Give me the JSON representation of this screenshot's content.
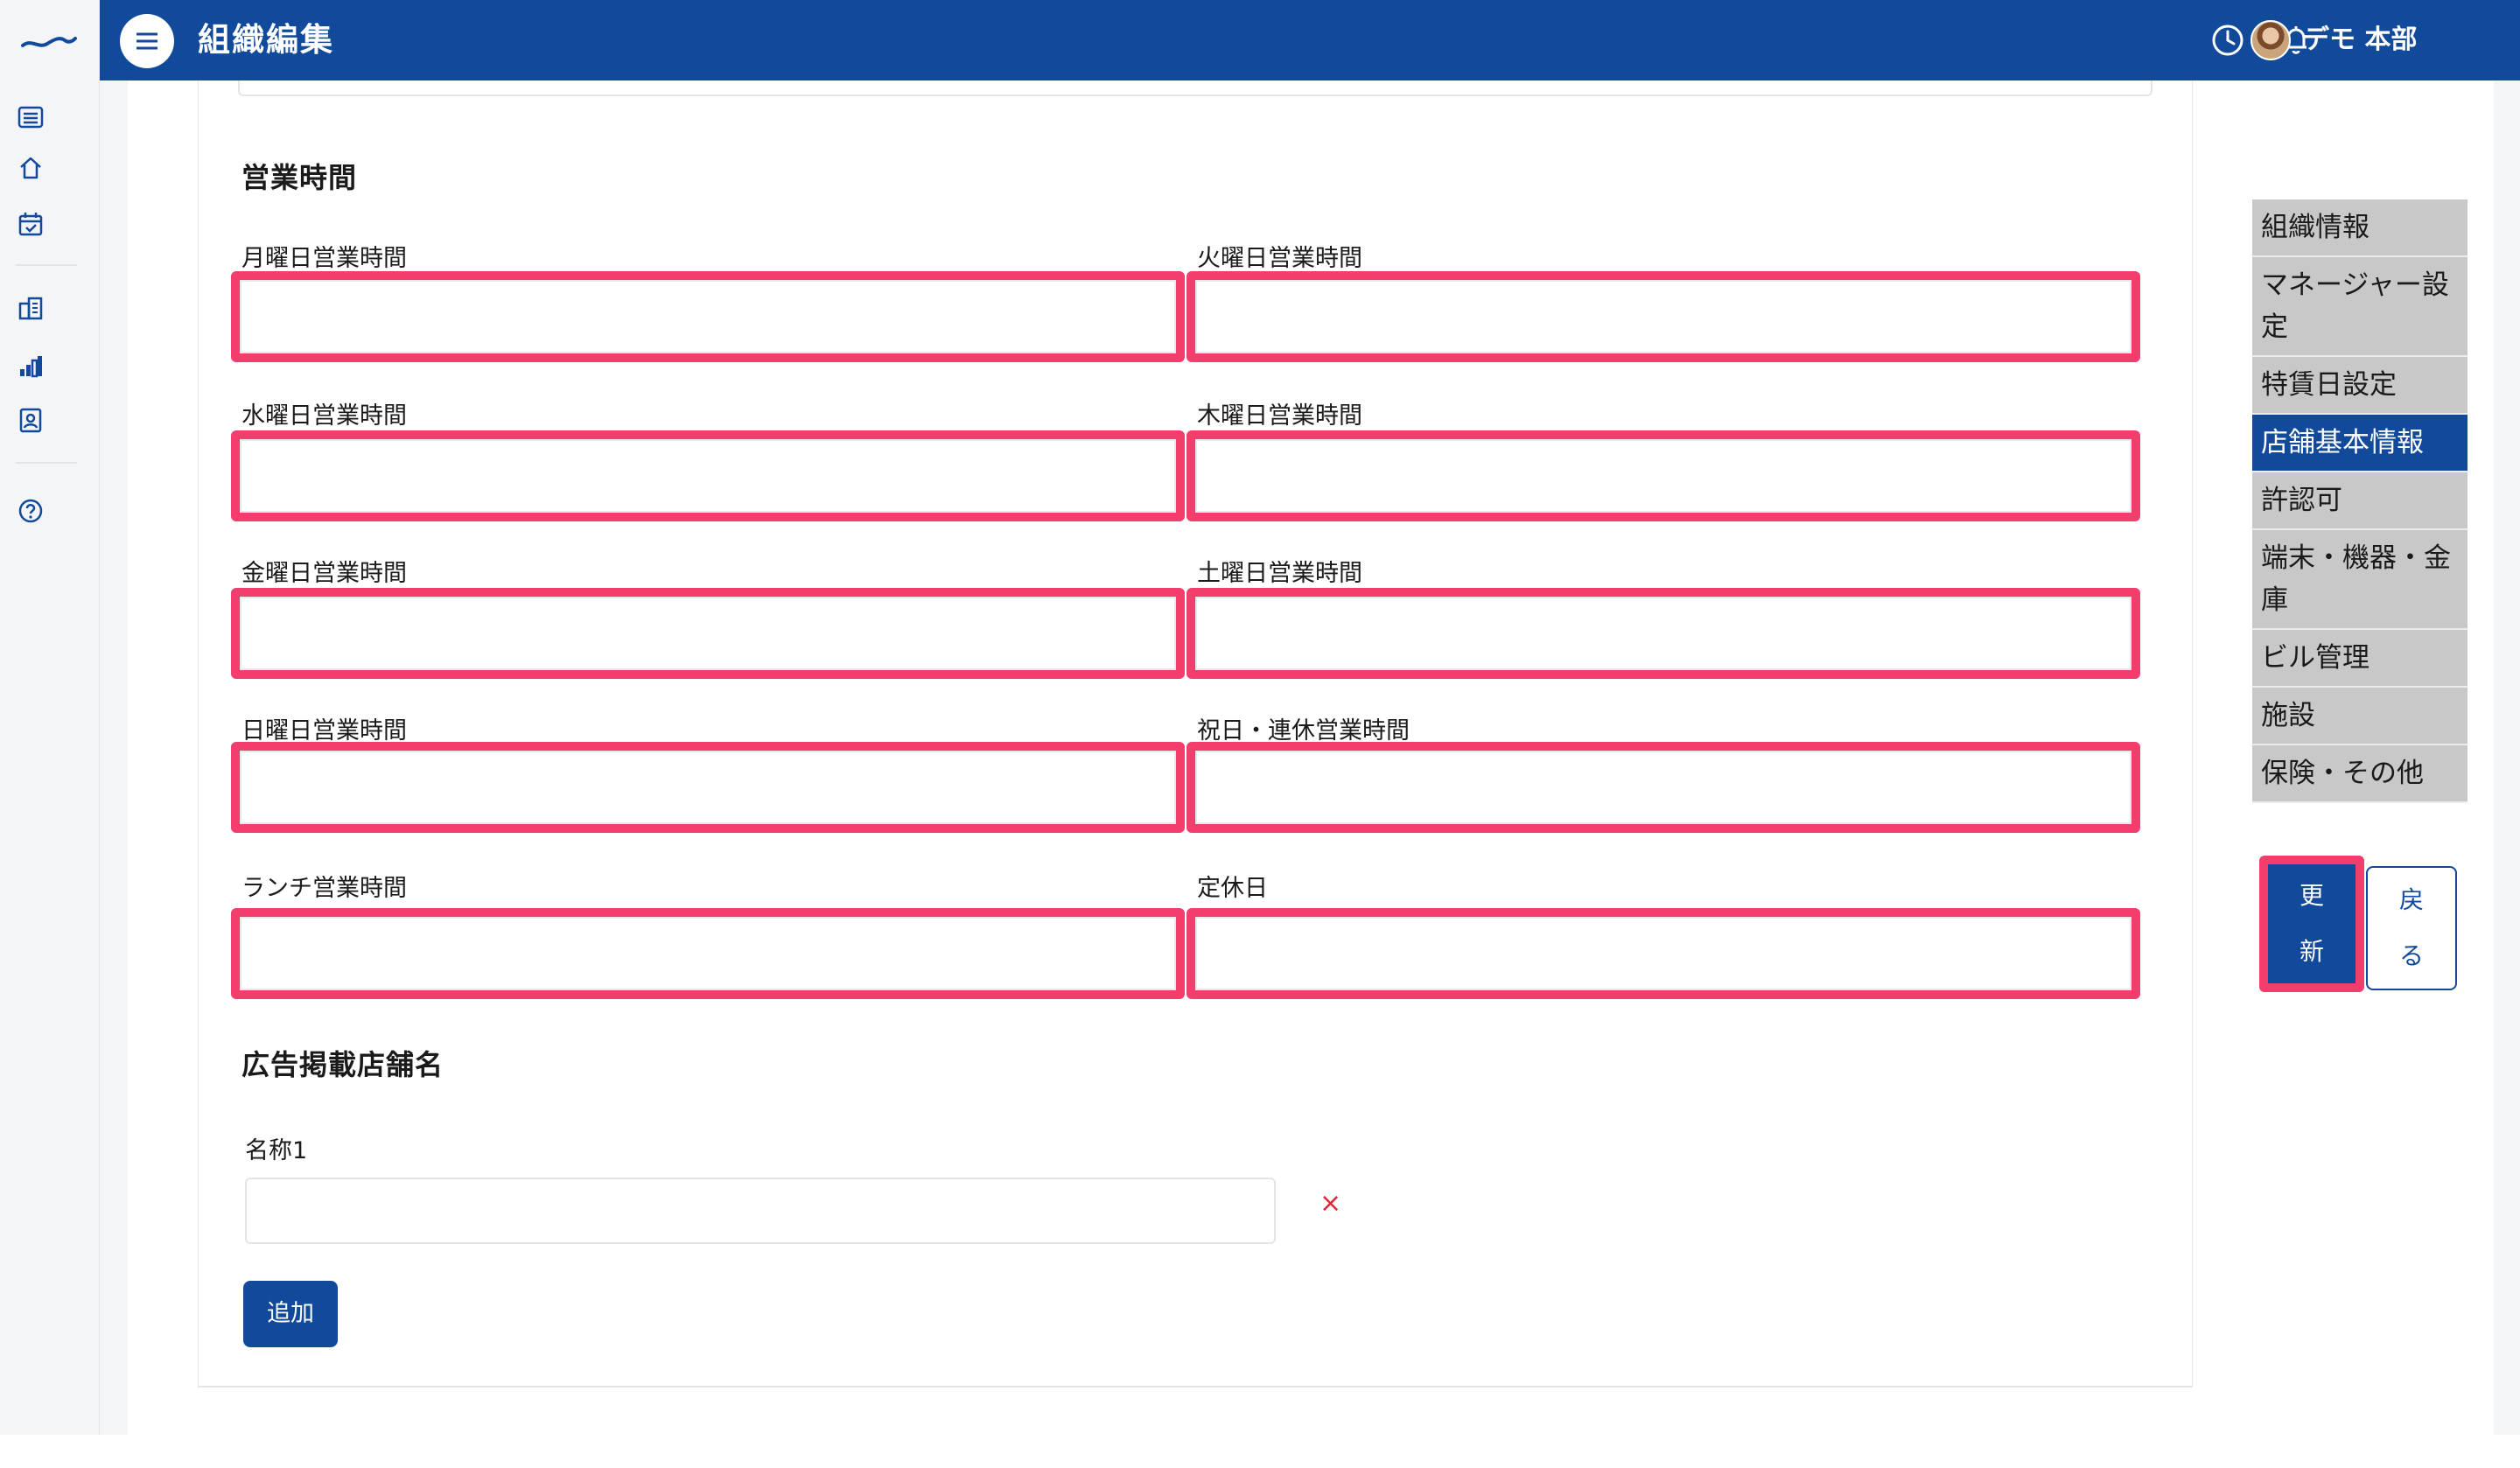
{
  "header": {
    "title": "組織編集",
    "user_name": "デモ 本部",
    "icons": [
      "menu-icon",
      "clock-icon",
      "bell-icon",
      "avatar"
    ]
  },
  "rail": {
    "icons": [
      "logo-icon",
      "list-icon",
      "home-icon",
      "calendar-check-icon",
      "building-icon",
      "bar-chart-icon",
      "id-card-icon",
      "help-icon"
    ]
  },
  "business_hours": {
    "section_title": "営業時間",
    "fields": [
      {
        "label": "月曜日営業時間",
        "value": ""
      },
      {
        "label": "火曜日営業時間",
        "value": ""
      },
      {
        "label": "水曜日営業時間",
        "value": ""
      },
      {
        "label": "木曜日営業時間",
        "value": ""
      },
      {
        "label": "金曜日営業時間",
        "value": ""
      },
      {
        "label": "土曜日営業時間",
        "value": ""
      },
      {
        "label": "日曜日営業時間",
        "value": ""
      },
      {
        "label": "祝日・連休営業時間",
        "value": ""
      },
      {
        "label": "ランチ営業時間",
        "value": ""
      },
      {
        "label": "定休日",
        "value": ""
      }
    ]
  },
  "ad_store_name": {
    "section_title": "広告掲載店舗名",
    "name_label": "名称1",
    "name_value": "",
    "remove_label": "×",
    "add_label": "追加"
  },
  "side_nav": {
    "items": [
      {
        "label": "組織情報",
        "active": false
      },
      {
        "label": "マネージャー設定",
        "active": false
      },
      {
        "label": "特賃日設定",
        "active": false
      },
      {
        "label": "店舗基本情報",
        "active": true
      },
      {
        "label": "許認可",
        "active": false
      },
      {
        "label": "端末・機器・金庫",
        "active": false
      },
      {
        "label": "ビル管理",
        "active": false
      },
      {
        "label": "施設",
        "active": false
      },
      {
        "label": "保険・その他",
        "active": false
      }
    ]
  },
  "actions": {
    "update_label_1": "更",
    "update_label_2": "新",
    "back_label_1": "戻",
    "back_label_2": "る"
  },
  "colors": {
    "brand": "#114a9a",
    "highlight": "#f23d6d",
    "nav_bg": "#c8c8c8",
    "danger": "#e0283a"
  }
}
